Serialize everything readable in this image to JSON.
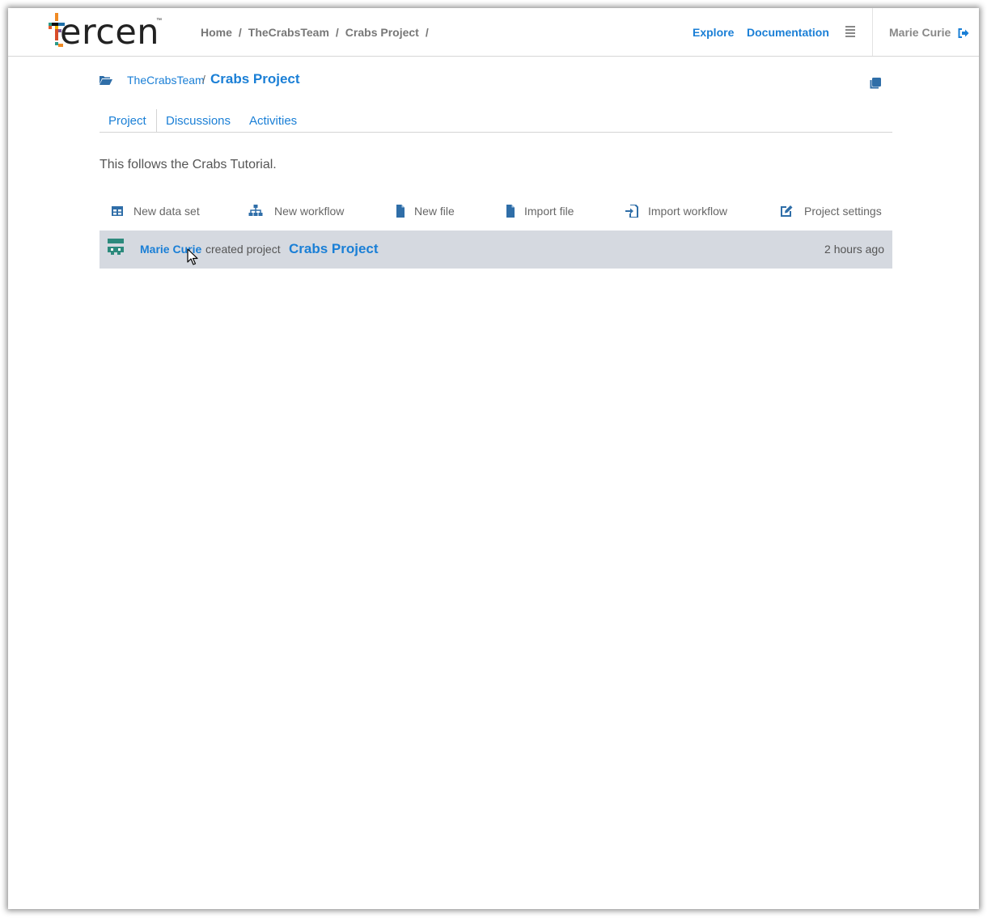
{
  "header": {
    "logo_text": "ercen",
    "logo_tm": "™",
    "breadcrumb": [
      "Home",
      "TheCrabsTeam",
      "Crabs Project"
    ],
    "breadcrumb_sep": "/",
    "explore_label": "Explore",
    "documentation_label": "Documentation",
    "user_name": "Marie Curie"
  },
  "project_crumb": {
    "team": "TheCrabsTeam",
    "slash": "/",
    "project": "Crabs Project"
  },
  "tabs": [
    {
      "label": "Project",
      "active": true
    },
    {
      "label": "Discussions",
      "active": false
    },
    {
      "label": "Activities",
      "active": false
    }
  ],
  "description": "This follows the Crabs Tutorial.",
  "actions": [
    {
      "label": "New data set",
      "icon": "table-icon"
    },
    {
      "label": "New workflow",
      "icon": "sitemap-icon"
    },
    {
      "label": "New file",
      "icon": "file-icon"
    },
    {
      "label": "Import file",
      "icon": "file-icon"
    },
    {
      "label": "Import workflow",
      "icon": "import-icon"
    },
    {
      "label": "Project settings",
      "icon": "edit-icon"
    }
  ],
  "activity": {
    "user": "Marie Curie",
    "verb": "created project",
    "project": "Crabs Project",
    "time": "2 hours ago"
  },
  "colors": {
    "accent": "#1a7fd6",
    "activity_bg": "#d5d9e0",
    "action_icon": "#2f6ea8"
  }
}
